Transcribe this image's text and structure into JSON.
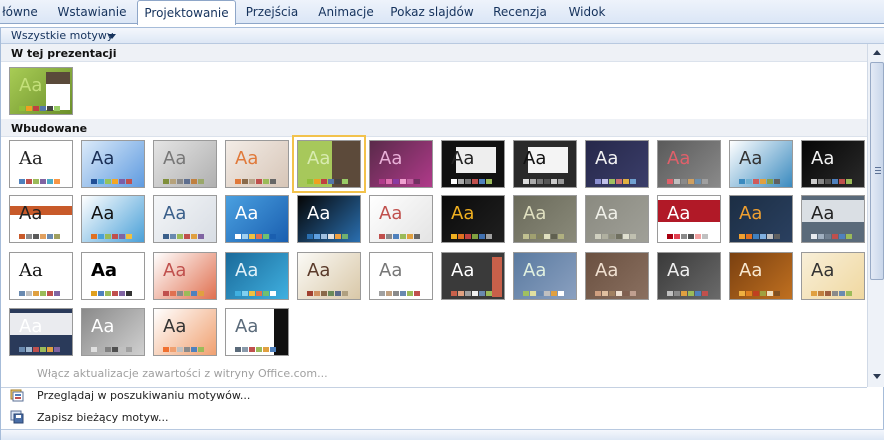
{
  "ribbon": {
    "tabs": [
      {
        "label": "łówne",
        "active": false
      },
      {
        "label": "Wstawianie",
        "active": false
      },
      {
        "label": "Projektowanie",
        "active": true
      },
      {
        "label": "Przejścia",
        "active": false
      },
      {
        "label": "Animacje",
        "active": false
      },
      {
        "label": "Pokaz slajdów",
        "active": false
      },
      {
        "label": "Recenzja",
        "active": false
      },
      {
        "label": "Widok",
        "active": false
      }
    ]
  },
  "gallery": {
    "filter_label": "Wszystkie motywy",
    "section_current": "W tej prezentacji",
    "section_builtin": "Wbudowane",
    "current_theme": {
      "bg": "#a8cc55",
      "bg2": "#6b8f2a",
      "aa_color": "#c4e07a",
      "accent": "#5a4a3a",
      "swatches": [
        "#8fbf3a",
        "#f0a020",
        "#c04040",
        "#5577aa",
        "#444444",
        "#99cc66"
      ]
    },
    "themes": [
      {
        "bg": "#ffffff",
        "bg2": "#ffffff",
        "aa": "#222222",
        "style": "plain",
        "swatches": [
          "#4f81bd",
          "#c0504d",
          "#9bbb59",
          "#8064a2",
          "#4bacc6",
          "#f79646"
        ]
      },
      {
        "bg": "#dbeaf9",
        "bg2": "#5f9be0",
        "aa": "#1a2f55",
        "style": "blue-swirl",
        "swatches": [
          "#1f4e96",
          "#4aa5d8",
          "#95c35b",
          "#f5a623",
          "#7b5ea7",
          "#c0504d"
        ]
      },
      {
        "bg": "#e4e4e4",
        "bg2": "#b0b0b0",
        "aa": "#777777",
        "style": "grey-bar",
        "swatches": [
          "#7f8f3a",
          "#b6a27b",
          "#8a8a8a",
          "#5d6e8f",
          "#c08040",
          "#9aa86a"
        ]
      },
      {
        "bg": "#f3ece6",
        "bg2": "#d7c6b8",
        "aa": "#e0793a",
        "style": "peach",
        "swatches": [
          "#e0793a",
          "#8a6a4a",
          "#b8a48a",
          "#c0504d",
          "#9bbb59",
          "#666666"
        ]
      },
      {
        "bg": "#a7c85b",
        "bg2": "#5c4a3a",
        "aa": "#d8ebb0",
        "style": "green-brown",
        "swatches": [
          "#8fbf3a",
          "#f0a020",
          "#c04040",
          "#5577aa",
          "#444444",
          "#99cc66"
        ]
      },
      {
        "bg": "#5a2a4a",
        "bg2": "#b03a8a",
        "aa": "#e9b0d8",
        "style": "purple",
        "swatches": [
          "#b03a8a",
          "#e070b0",
          "#8a3aa0",
          "#f0a0d0",
          "#c060a0",
          "#703060"
        ]
      },
      {
        "bg": "#111111",
        "bg2": "#eeeeee",
        "aa": "#222222",
        "style": "black-white",
        "swatches": [
          "#ffffff",
          "#aaaaaa",
          "#777777",
          "#c0504d",
          "#4f81bd",
          "#9bbb59"
        ]
      },
      {
        "bg": "#2a2a2a",
        "bg2": "#f4f4f4",
        "aa": "#111111",
        "style": "torn",
        "swatches": [
          "#dddddd",
          "#aaaaaa",
          "#777777",
          "#555555",
          "#cccccc",
          "#999999"
        ]
      },
      {
        "bg": "#26284a",
        "bg2": "#3b3e6a",
        "aa": "#f2f2f2",
        "style": "navy",
        "swatches": [
          "#8a8fd0",
          "#c0c0e8",
          "#a0c060",
          "#d07070",
          "#e0b040",
          "#70a0d0"
        ]
      },
      {
        "bg": "#5a5a5a",
        "bg2": "#8a8a8a",
        "aa": "#e0606a",
        "style": "grey-red",
        "swatches": [
          "#e0606a",
          "#c0c0c0",
          "#8a8a8a",
          "#d0a060",
          "#6a90b0",
          "#a0a0a0"
        ]
      },
      {
        "bg": "#ffffff",
        "bg2": "#3a8abf",
        "aa": "#333333",
        "style": "white-blue-wave",
        "swatches": [
          "#3a8abf",
          "#70b0d0",
          "#d05a5a",
          "#e0a040",
          "#80a050",
          "#606060"
        ]
      },
      {
        "bg": "#050505",
        "bg2": "#2a2a2a",
        "aa": "#f2f2f2",
        "style": "black",
        "swatches": [
          "#cccccc",
          "#888888",
          "#555555",
          "#4f81bd",
          "#c0504d",
          "#9bbb59"
        ]
      },
      {
        "bg": "#ffffff",
        "bg2": "#c85a2a",
        "aa": "#222222",
        "style": "red-band",
        "swatches": [
          "#c85a2a",
          "#8a8a8a",
          "#5a5a5a",
          "#e0a060",
          "#6a8ab0",
          "#a0a060"
        ]
      },
      {
        "bg": "#ffffff",
        "bg2": "#4aa0d8",
        "aa": "#111111",
        "style": "orange-blue",
        "swatches": [
          "#e07020",
          "#4aa0d8",
          "#9bbb59",
          "#c0504d",
          "#8064a2",
          "#f0c040"
        ]
      },
      {
        "bg": "#f4f6f8",
        "bg2": "#d8dde4",
        "aa": "#3a5f8a",
        "style": "light",
        "swatches": [
          "#3a5f8a",
          "#6a8ab0",
          "#9bbb59",
          "#c0504d",
          "#e0a040",
          "#8064a2"
        ]
      },
      {
        "bg": "#4aa0e0",
        "bg2": "#1a5fb0",
        "aa": "#ffffff",
        "style": "sky",
        "swatches": [
          "#ffffff",
          "#a0d0f0",
          "#f0c040",
          "#e07050",
          "#70c070",
          "#1a5fb0"
        ]
      },
      {
        "bg": "#050505",
        "bg2": "#2a6fb0",
        "aa": "#ffffff",
        "style": "black-blue",
        "swatches": [
          "#2a6fb0",
          "#60a0e0",
          "#a0c0e0",
          "#e0e0e0",
          "#f0a040",
          "#70b070"
        ]
      },
      {
        "bg": "#ffffff",
        "bg2": "#e4e4e4",
        "aa": "#c0504d",
        "style": "white-red",
        "swatches": [
          "#c0504d",
          "#8a8a8a",
          "#4f81bd",
          "#9bbb59",
          "#e0a040",
          "#666666"
        ]
      },
      {
        "bg": "#0a0a0a",
        "bg2": "#202020",
        "aa": "#f0b020",
        "style": "black-gold",
        "swatches": [
          "#f0b020",
          "#e07020",
          "#c04040",
          "#80a040",
          "#4070b0",
          "#a0a0a0"
        ]
      },
      {
        "bg": "#6a6a5a",
        "bg2": "#8a8a7a",
        "aa": "#e0e0c0",
        "style": "olive-grey",
        "swatches": [
          "#c0c090",
          "#a0a070",
          "#808060",
          "#e0e0c0",
          "#606050",
          "#b0b080"
        ]
      },
      {
        "bg": "#8a8a80",
        "bg2": "#a0a098",
        "aa": "#f0f0e8",
        "style": "stone",
        "swatches": [
          "#d0d0c0",
          "#b0b0a0",
          "#909080",
          "#707060",
          "#e0e0d0",
          "#c0c0b0"
        ]
      },
      {
        "bg": "#ffffff",
        "bg2": "#a80010",
        "aa": "#ffffff",
        "style": "red-block",
        "swatches": [
          "#a80010",
          "#e04050",
          "#8a8a8a",
          "#505050",
          "#f0a0a0",
          "#c0c0c0"
        ]
      },
      {
        "bg": "#1c2e44",
        "bg2": "#2a4060",
        "aa": "#f0a030",
        "style": "dark-blue-orange",
        "swatches": [
          "#f0a030",
          "#e07020",
          "#4080c0",
          "#80b0e0",
          "#c0c0c0",
          "#606060"
        ]
      },
      {
        "bg": "#5a6a7a",
        "bg2": "#e8ecf0",
        "aa": "#222222",
        "style": "slate",
        "swatches": [
          "#e8ecf0",
          "#a0b0c0",
          "#708090",
          "#c0504d",
          "#4f81bd",
          "#9bbb59"
        ]
      },
      {
        "bg": "#ffffff",
        "bg2": "#ffffff",
        "aa": "#111111",
        "style": "plain-serif",
        "swatches": [
          "#6a8ab0",
          "#c0c0c0",
          "#e0a040",
          "#9bbb59",
          "#c0504d",
          "#8064a2"
        ]
      },
      {
        "bg": "#ffffff",
        "bg2": "#ffffff",
        "aa": "#000000",
        "style": "bold",
        "swatches": [
          "#e0a020",
          "#4f81bd",
          "#9bbb59",
          "#c0504d",
          "#8064a2",
          "#333333"
        ]
      },
      {
        "bg": "#ffffff",
        "bg2": "#e07050",
        "aa": "#c0504d",
        "style": "white-coral",
        "swatches": [
          "#c0504d",
          "#e07050",
          "#8a8a8a",
          "#9bbb59",
          "#4f81bd",
          "#e0a040"
        ]
      },
      {
        "bg": "#1a6a9a",
        "bg2": "#40b0e0",
        "aa": "#e0f0f8",
        "style": "teal-wave",
        "swatches": [
          "#40b0e0",
          "#80d0f0",
          "#f0c040",
          "#e07050",
          "#70c070",
          "#ffffff"
        ]
      },
      {
        "bg": "#fbfaf6",
        "bg2": "#d9c8a8",
        "aa": "#5a3a2a",
        "style": "cream",
        "swatches": [
          "#a04030",
          "#d09060",
          "#8a6a4a",
          "#6a8a5a",
          "#5a6a8a",
          "#b0a080"
        ]
      },
      {
        "bg": "#ffffff",
        "bg2": "#eeeeee",
        "aa": "#777777",
        "style": "white-grey",
        "swatches": [
          "#a0a0a0",
          "#c0a080",
          "#8a8a8a",
          "#6a8ab0",
          "#9bbb59",
          "#c0504d"
        ]
      },
      {
        "bg": "#3a3a3a",
        "bg2": "#c8604a",
        "aa": "#ffffff",
        "style": "dark-rust",
        "swatches": [
          "#c8604a",
          "#e0a080",
          "#a0a0a0",
          "#f0f0f0",
          "#6a8ab0",
          "#9bbb59"
        ]
      },
      {
        "bg": "#5a7aa0",
        "bg2": "#8aa0c0",
        "aa": "#e0f0e0",
        "style": "stripes",
        "swatches": [
          "#a0c060",
          "#e0e0a0",
          "#6a8ab0",
          "#c0c0c0",
          "#e0a040",
          "#ffffff"
        ]
      },
      {
        "bg": "#6a5040",
        "bg2": "#8a7060",
        "aa": "#f0e0d0",
        "style": "brown",
        "swatches": [
          "#d0a080",
          "#e0c0a0",
          "#a08060",
          "#f0e0d0",
          "#806050",
          "#c0a090"
        ]
      },
      {
        "bg": "#3a3a3a",
        "bg2": "#6a6a6a",
        "aa": "#f0f0f0",
        "style": "charcoal",
        "swatches": [
          "#c0c0c0",
          "#8a8a8a",
          "#e0a040",
          "#9bbb59",
          "#4f81bd",
          "#c0504d"
        ]
      },
      {
        "bg": "#7a4010",
        "bg2": "#c07020",
        "aa": "#f8e8d0",
        "style": "amber",
        "swatches": [
          "#f0b040",
          "#e08020",
          "#c04020",
          "#a0a040",
          "#f0e0c0",
          "#805020"
        ]
      },
      {
        "bg": "#f8efd8",
        "bg2": "#f0d8a0",
        "aa": "#333333",
        "style": "sand",
        "swatches": [
          "#e0a040",
          "#c08040",
          "#a06040",
          "#8a8a8a",
          "#6a8ab0",
          "#9bbb59"
        ]
      },
      {
        "bg": "#2a3a5a",
        "bg2": "#ffffff",
        "aa": "#ffffff",
        "style": "navy-band",
        "swatches": [
          "#6a8ab0",
          "#a0b8d0",
          "#c0504d",
          "#9bbb59",
          "#e0a040",
          "#8064a2"
        ]
      },
      {
        "bg": "#8a8a8a",
        "bg2": "#d0d0d0",
        "aa": "#ffffff",
        "style": "silver",
        "swatches": [
          "#e0e0e0",
          "#b0b0b0",
          "#808080",
          "#505050",
          "#c0c0c0",
          "#a0a0a0"
        ]
      },
      {
        "bg": "#ffffff",
        "bg2": "#f0a070",
        "aa": "#333333",
        "style": "orange-dots",
        "swatches": [
          "#f07030",
          "#f0a070",
          "#c0c0c0",
          "#8a8a8a",
          "#4f81bd",
          "#9bbb59"
        ]
      },
      {
        "bg": "#ffffff",
        "bg2": "#111111",
        "aa": "#5a6a7a",
        "style": "white-black-edge",
        "swatches": [
          "#5a6a7a",
          "#8a9aaa",
          "#c0504d",
          "#9bbb59",
          "#e0a040",
          "#4f81bd"
        ]
      }
    ]
  },
  "menu": {
    "enable_updates": "Włącz aktualizacje zawartości z witryny Office.com...",
    "browse": "Przeglądaj w poszukiwaniu motywów...",
    "save": "Zapisz bieżący motyw..."
  }
}
